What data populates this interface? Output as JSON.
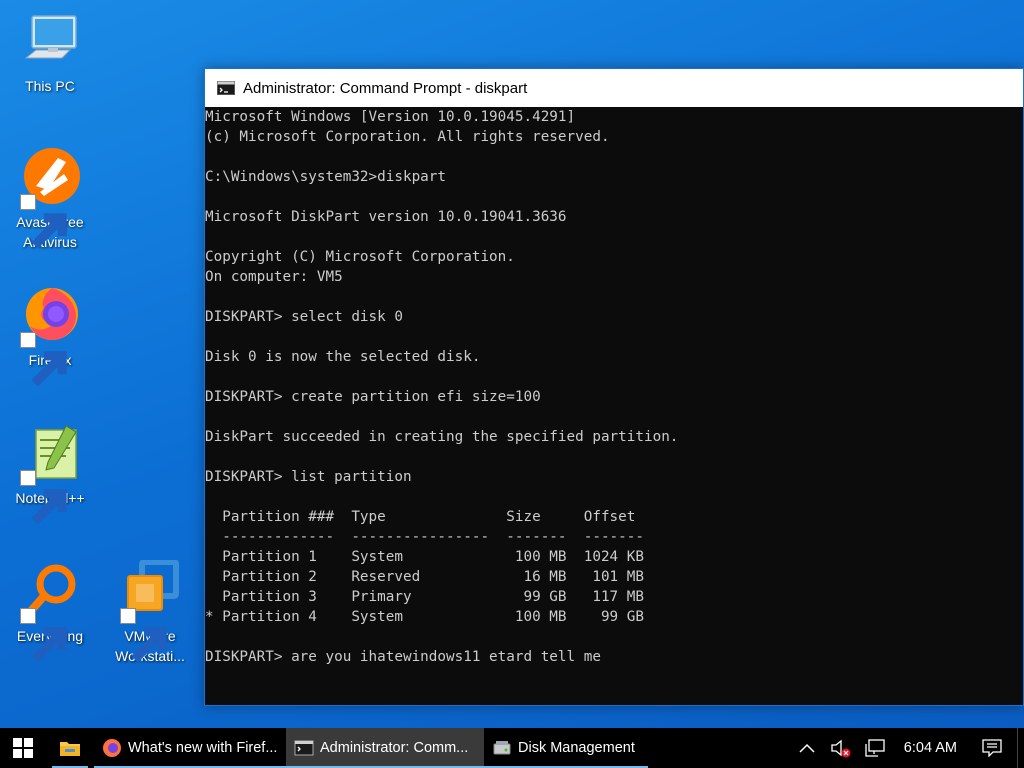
{
  "desktop": {
    "icons": [
      {
        "label": "This PC"
      },
      {
        "label": "Avast Free Antivirus"
      },
      {
        "label": "Firefox"
      },
      {
        "label": "Notepad++"
      },
      {
        "label": "Everything"
      },
      {
        "label": "VMware Workstati..."
      }
    ]
  },
  "cmd_window": {
    "title": "Administrator: Command Prompt - diskpart",
    "lines": [
      "Microsoft Windows [Version 10.0.19045.4291]",
      "(c) Microsoft Corporation. All rights reserved.",
      "",
      "C:\\Windows\\system32>diskpart",
      "",
      "Microsoft DiskPart version 10.0.19041.3636",
      "",
      "Copyright (C) Microsoft Corporation.",
      "On computer: VM5",
      "",
      "DISKPART> select disk 0",
      "",
      "Disk 0 is now the selected disk.",
      "",
      "DISKPART> create partition efi size=100",
      "",
      "DiskPart succeeded in creating the specified partition.",
      "",
      "DISKPART> list partition",
      "",
      "  Partition ###  Type              Size     Offset",
      "  -------------  ----------------  -------  -------",
      "  Partition 1    System             100 MB  1024 KB",
      "  Partition 2    Reserved            16 MB   101 MB",
      "  Partition 3    Primary             99 GB   117 MB",
      "* Partition 4    System             100 MB    99 GB",
      "",
      "DISKPART> are you ihatewindows11 etard tell me"
    ]
  },
  "taskbar": {
    "items": [
      {
        "label": "What's new with Firef..."
      },
      {
        "label": "Administrator: Comm..."
      },
      {
        "label": "Disk Management"
      }
    ],
    "clock": "6:04 AM"
  },
  "colors": {
    "desktop_bg": "#0c6fd4",
    "console_bg": "#0c0c0c",
    "console_fg": "#cccccc",
    "taskbar_bg": "#000000",
    "taskbar_accent": "#76b9ed"
  }
}
